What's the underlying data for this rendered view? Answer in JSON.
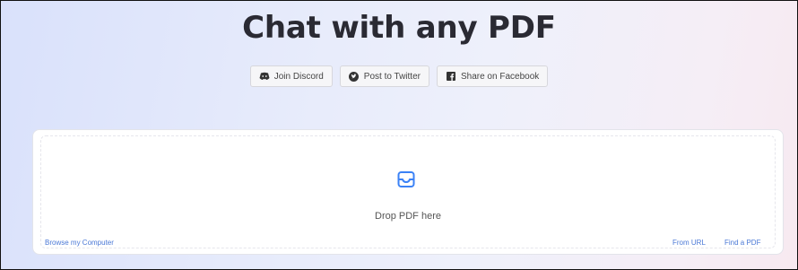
{
  "header": {
    "title": "Chat with any PDF"
  },
  "share": {
    "discord_label": "Join Discord",
    "twitter_label": "Post to Twitter",
    "facebook_label": "Share on Facebook"
  },
  "dropzone": {
    "text": "Drop PDF here",
    "browse_label": "Browse my Computer",
    "from_url_label": "From URL",
    "find_pdf_label": "Find a PDF"
  },
  "icons": {
    "discord": "discord-icon",
    "twitter": "twitter-icon",
    "facebook": "facebook-icon",
    "tray": "inbox-tray-icon"
  },
  "colors": {
    "title": "#2a2a33",
    "accent": "#3b82f6",
    "link": "#4a78d6"
  }
}
